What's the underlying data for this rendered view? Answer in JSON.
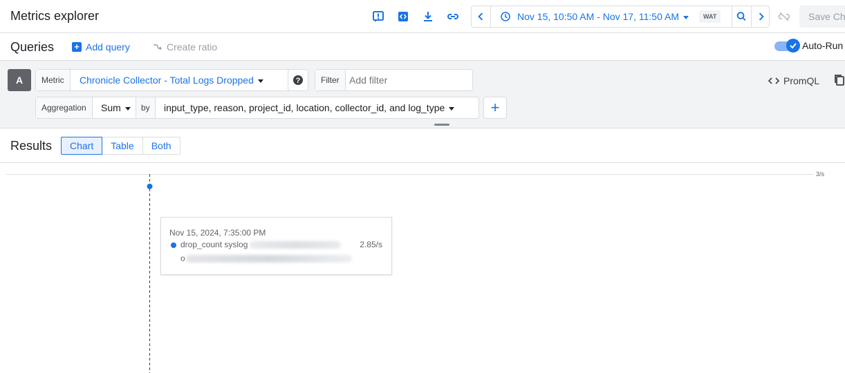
{
  "header": {
    "title": "Metrics explorer",
    "icons": [
      "feedback-icon",
      "code-icon",
      "download-icon",
      "link-icon"
    ],
    "time_range": "Nov 15, 10:50 AM - Nov 17, 11:50 AM",
    "timezone": "WAT",
    "save_label": "Save Ch"
  },
  "queries": {
    "title": "Queries",
    "add_query": "Add query",
    "create_ratio": "Create ratio",
    "autorun_label": "Auto-Run",
    "autorun_on": true
  },
  "query_a": {
    "badge": "A",
    "metric_label": "Metric",
    "metric_value": "Chronicle Collector - Total Logs Dropped",
    "filter_label": "Filter",
    "filter_placeholder": "Add filter",
    "promql_label": "PromQL",
    "aggregation_label": "Aggregation",
    "aggregation_value": "Sum",
    "by_label": "by",
    "group_by_value": "input_type, reason, project_id, location, collector_id, and log_type"
  },
  "results": {
    "title": "Results",
    "tabs": [
      "Chart",
      "Table",
      "Both"
    ],
    "active_tab": "Chart"
  },
  "chart_data": {
    "type": "line",
    "y_tick_labels": [
      "3/s"
    ],
    "ylim": [
      0,
      3
    ],
    "series": [
      {
        "name": "drop_count syslog",
        "color": "#1a73e8",
        "points": [
          {
            "x": "Nov 15, 2024, 7:35:00 PM",
            "y": 2.85
          }
        ]
      }
    ],
    "tooltip": {
      "date": "Nov 15, 2024, 7:35:00 PM",
      "series_label": "drop_count syslog",
      "value": "2.85/s",
      "continuation": "o"
    }
  },
  "colors": {
    "accent": "#1a73e8",
    "border": "#dadce0",
    "editor_bg": "#f1f3f4"
  }
}
